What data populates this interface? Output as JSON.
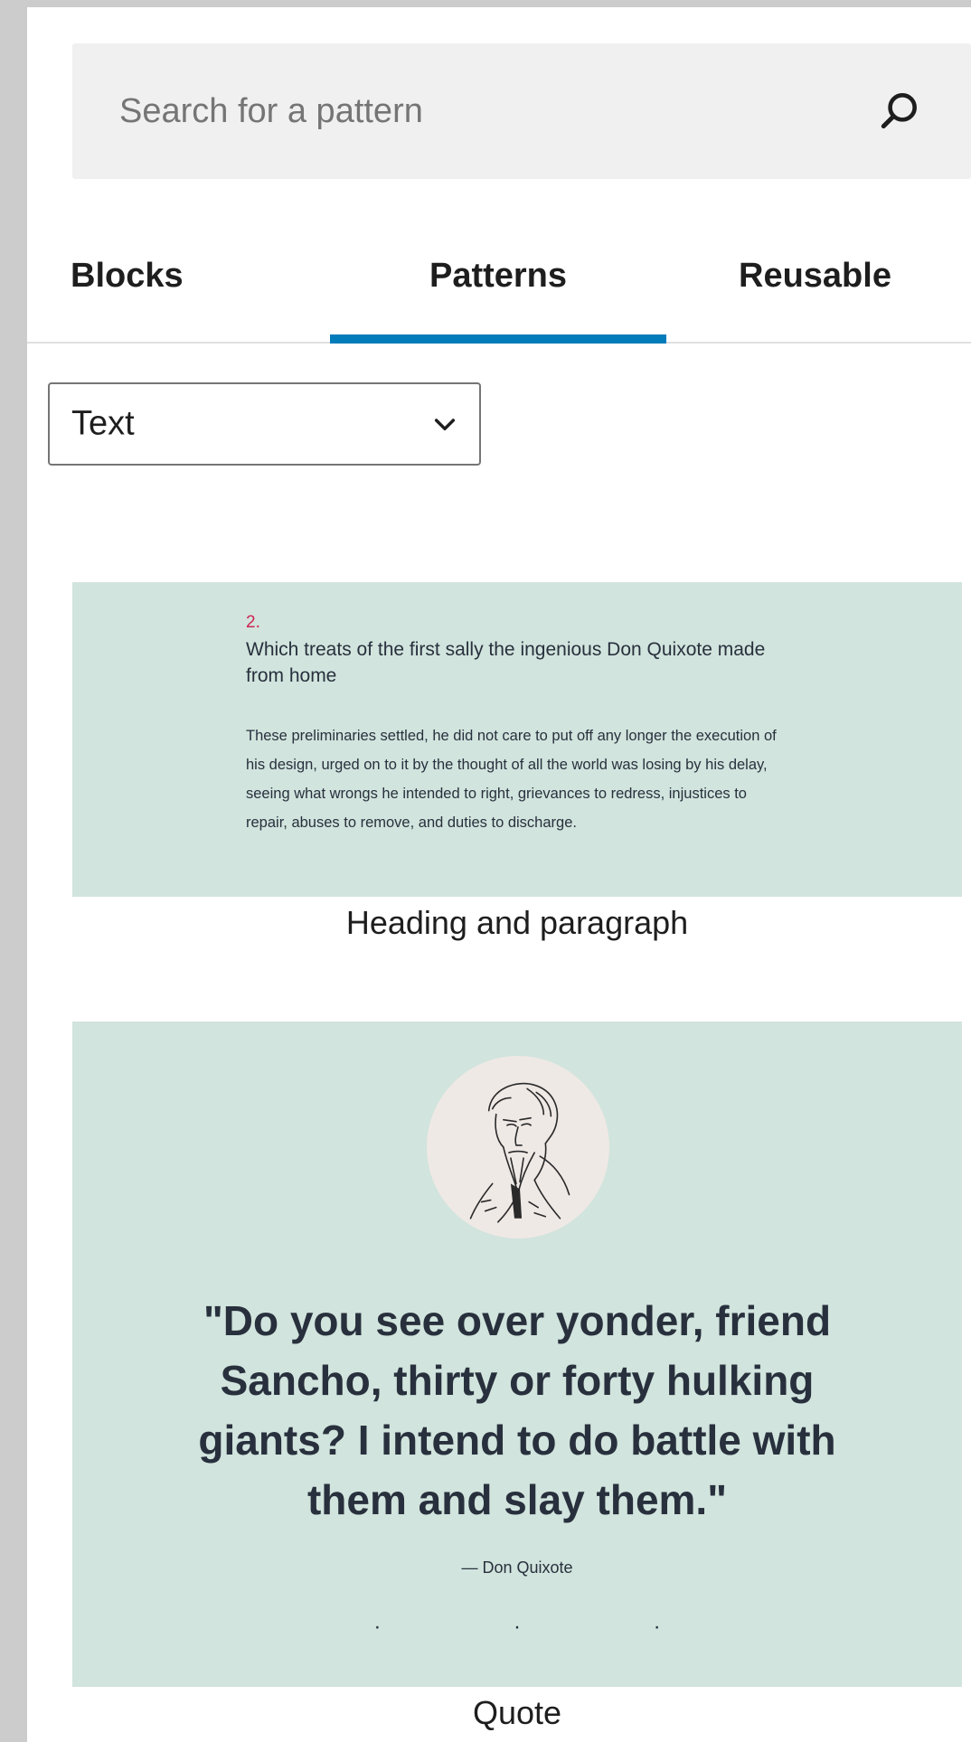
{
  "search": {
    "placeholder": "Search for a pattern"
  },
  "tabs": [
    {
      "label": "Blocks",
      "active": false
    },
    {
      "label": "Patterns",
      "active": true
    },
    {
      "label": "Reusable",
      "active": false
    }
  ],
  "category_select": {
    "selected": "Text"
  },
  "patterns": [
    {
      "name": "Heading and paragraph",
      "preview": {
        "number": "2.",
        "heading": "Which treats of the first sally the ingenious Don Quixote made from home",
        "paragraph": "These preliminaries settled, he did not care to put off any longer the execution of his design, urged on to it by the thought of all the world was losing by his delay, seeing what wrongs he intended to right, grievances to redress, injustices to repair, abuses to remove, and duties to discharge."
      }
    },
    {
      "name": "Quote",
      "preview": {
        "quote": "\"Do you see over yonder, friend Sancho, thirty or forty hulking giants? I intend to do battle with them and slay them.\"",
        "citation": "— Don Quixote",
        "separator": "· · ·"
      }
    }
  ],
  "colors": {
    "accent": "#007cba",
    "preview_background": "#d1e4dd",
    "preview_text": "#28303d",
    "number_accent": "#cd2653",
    "search_background": "#f0f0f0"
  },
  "icons": {
    "search": "search-icon",
    "dropdown": "chevron-down-icon",
    "portrait": "don-quixote-portrait"
  }
}
